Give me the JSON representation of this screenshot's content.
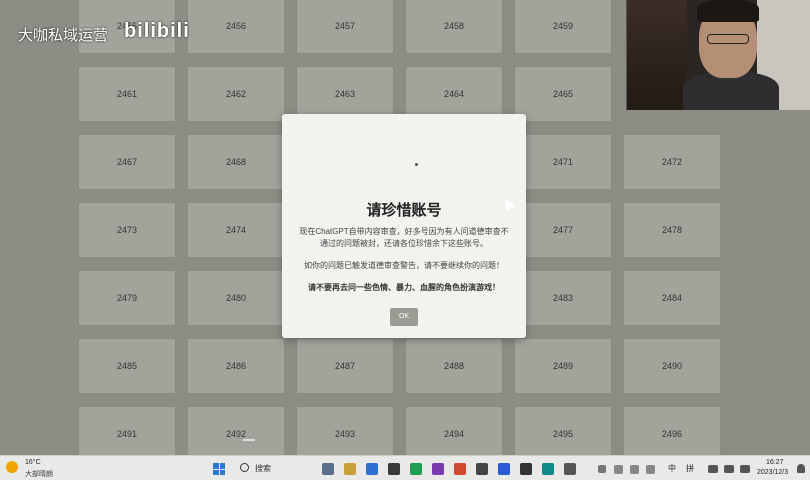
{
  "watermark": {
    "text": "大咖私域运营",
    "logo": "bilibili"
  },
  "grid": {
    "tiles": [
      "2455",
      "2456",
      "2457",
      "2458",
      "2459",
      "2461",
      "2462",
      "2463",
      "2464",
      "2465",
      "2467",
      "2468",
      "2471",
      "2472",
      "2473",
      "2474",
      "2477",
      "2478",
      "2479",
      "2480",
      "2483",
      "2484",
      "2485",
      "2486",
      "2487",
      "2488",
      "2489",
      "2490",
      "2491",
      "2492",
      "2493",
      "2494",
      "2495",
      "2496"
    ]
  },
  "modal": {
    "title": "请珍惜账号",
    "paragraph1": "现在ChatGPT自带内容审查，好多号因为有人问道德审查不通过的问题被封，还请各位珍惜余下这些账号。",
    "paragraph2": "如你的问题已触发道德审查警告，请不要继续你的问题！",
    "paragraph3": "请不要再去问一些色情、暴力、血腥的角色扮演游戏！",
    "button_label": "OK"
  },
  "taskbar": {
    "weather_temp": "16°C",
    "weather_desc": "大部晴朗",
    "search_label": "搜索",
    "ime_lang": "中",
    "ime_mode": "拼",
    "time": "16:27",
    "date": "2023/12/3"
  },
  "colors": {
    "start": "#2b78d4",
    "weather": "#f0a500"
  }
}
